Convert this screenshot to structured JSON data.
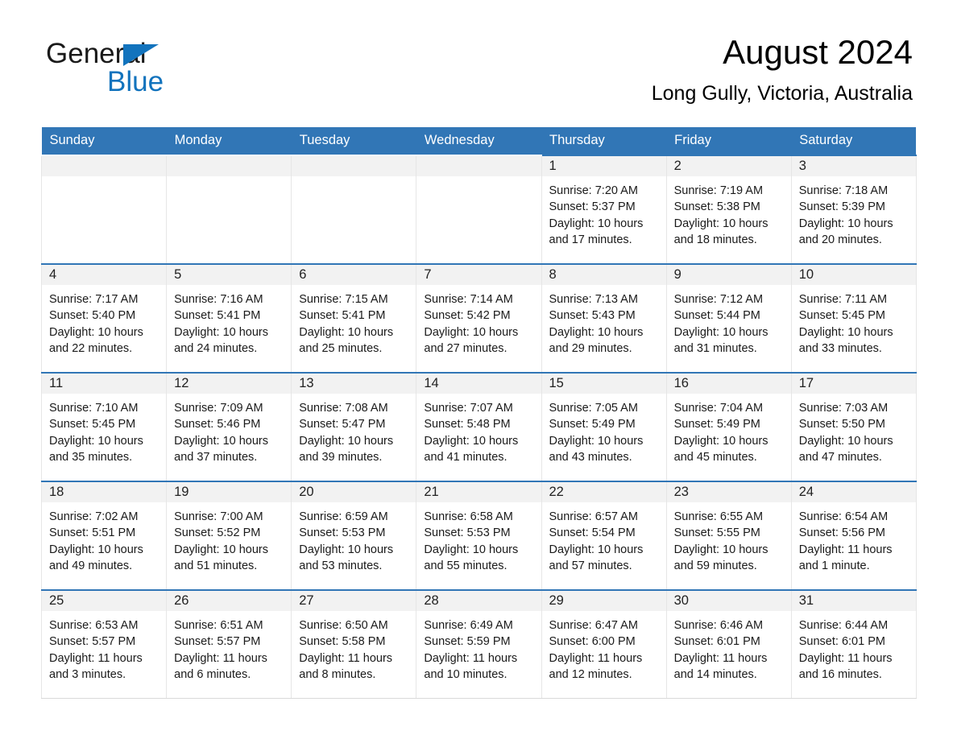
{
  "brand": {
    "word1": "General",
    "word2": "Blue",
    "accent_color": "#1273bd"
  },
  "header": {
    "title": "August 2024",
    "location": "Long Gully, Victoria, Australia"
  },
  "theme": {
    "header_blue": "#3176b6",
    "daynum_band": "#f2f2f2",
    "cell_bg": "#ffffff",
    "text": "#1a1a1a"
  },
  "calendar": {
    "weekday_headers": [
      "Sunday",
      "Monday",
      "Tuesday",
      "Wednesday",
      "Thursday",
      "Friday",
      "Saturday"
    ],
    "weeks": [
      [
        {
          "day": "",
          "sunrise": "",
          "sunset": "",
          "daylight_line1": "",
          "daylight_line2": ""
        },
        {
          "day": "",
          "sunrise": "",
          "sunset": "",
          "daylight_line1": "",
          "daylight_line2": ""
        },
        {
          "day": "",
          "sunrise": "",
          "sunset": "",
          "daylight_line1": "",
          "daylight_line2": ""
        },
        {
          "day": "",
          "sunrise": "",
          "sunset": "",
          "daylight_line1": "",
          "daylight_line2": ""
        },
        {
          "day": "1",
          "sunrise": "Sunrise: 7:20 AM",
          "sunset": "Sunset: 5:37 PM",
          "daylight_line1": "Daylight: 10 hours",
          "daylight_line2": "and 17 minutes."
        },
        {
          "day": "2",
          "sunrise": "Sunrise: 7:19 AM",
          "sunset": "Sunset: 5:38 PM",
          "daylight_line1": "Daylight: 10 hours",
          "daylight_line2": "and 18 minutes."
        },
        {
          "day": "3",
          "sunrise": "Sunrise: 7:18 AM",
          "sunset": "Sunset: 5:39 PM",
          "daylight_line1": "Daylight: 10 hours",
          "daylight_line2": "and 20 minutes."
        }
      ],
      [
        {
          "day": "4",
          "sunrise": "Sunrise: 7:17 AM",
          "sunset": "Sunset: 5:40 PM",
          "daylight_line1": "Daylight: 10 hours",
          "daylight_line2": "and 22 minutes."
        },
        {
          "day": "5",
          "sunrise": "Sunrise: 7:16 AM",
          "sunset": "Sunset: 5:41 PM",
          "daylight_line1": "Daylight: 10 hours",
          "daylight_line2": "and 24 minutes."
        },
        {
          "day": "6",
          "sunrise": "Sunrise: 7:15 AM",
          "sunset": "Sunset: 5:41 PM",
          "daylight_line1": "Daylight: 10 hours",
          "daylight_line2": "and 25 minutes."
        },
        {
          "day": "7",
          "sunrise": "Sunrise: 7:14 AM",
          "sunset": "Sunset: 5:42 PM",
          "daylight_line1": "Daylight: 10 hours",
          "daylight_line2": "and 27 minutes."
        },
        {
          "day": "8",
          "sunrise": "Sunrise: 7:13 AM",
          "sunset": "Sunset: 5:43 PM",
          "daylight_line1": "Daylight: 10 hours",
          "daylight_line2": "and 29 minutes."
        },
        {
          "day": "9",
          "sunrise": "Sunrise: 7:12 AM",
          "sunset": "Sunset: 5:44 PM",
          "daylight_line1": "Daylight: 10 hours",
          "daylight_line2": "and 31 minutes."
        },
        {
          "day": "10",
          "sunrise": "Sunrise: 7:11 AM",
          "sunset": "Sunset: 5:45 PM",
          "daylight_line1": "Daylight: 10 hours",
          "daylight_line2": "and 33 minutes."
        }
      ],
      [
        {
          "day": "11",
          "sunrise": "Sunrise: 7:10 AM",
          "sunset": "Sunset: 5:45 PM",
          "daylight_line1": "Daylight: 10 hours",
          "daylight_line2": "and 35 minutes."
        },
        {
          "day": "12",
          "sunrise": "Sunrise: 7:09 AM",
          "sunset": "Sunset: 5:46 PM",
          "daylight_line1": "Daylight: 10 hours",
          "daylight_line2": "and 37 minutes."
        },
        {
          "day": "13",
          "sunrise": "Sunrise: 7:08 AM",
          "sunset": "Sunset: 5:47 PM",
          "daylight_line1": "Daylight: 10 hours",
          "daylight_line2": "and 39 minutes."
        },
        {
          "day": "14",
          "sunrise": "Sunrise: 7:07 AM",
          "sunset": "Sunset: 5:48 PM",
          "daylight_line1": "Daylight: 10 hours",
          "daylight_line2": "and 41 minutes."
        },
        {
          "day": "15",
          "sunrise": "Sunrise: 7:05 AM",
          "sunset": "Sunset: 5:49 PM",
          "daylight_line1": "Daylight: 10 hours",
          "daylight_line2": "and 43 minutes."
        },
        {
          "day": "16",
          "sunrise": "Sunrise: 7:04 AM",
          "sunset": "Sunset: 5:49 PM",
          "daylight_line1": "Daylight: 10 hours",
          "daylight_line2": "and 45 minutes."
        },
        {
          "day": "17",
          "sunrise": "Sunrise: 7:03 AM",
          "sunset": "Sunset: 5:50 PM",
          "daylight_line1": "Daylight: 10 hours",
          "daylight_line2": "and 47 minutes."
        }
      ],
      [
        {
          "day": "18",
          "sunrise": "Sunrise: 7:02 AM",
          "sunset": "Sunset: 5:51 PM",
          "daylight_line1": "Daylight: 10 hours",
          "daylight_line2": "and 49 minutes."
        },
        {
          "day": "19",
          "sunrise": "Sunrise: 7:00 AM",
          "sunset": "Sunset: 5:52 PM",
          "daylight_line1": "Daylight: 10 hours",
          "daylight_line2": "and 51 minutes."
        },
        {
          "day": "20",
          "sunrise": "Sunrise: 6:59 AM",
          "sunset": "Sunset: 5:53 PM",
          "daylight_line1": "Daylight: 10 hours",
          "daylight_line2": "and 53 minutes."
        },
        {
          "day": "21",
          "sunrise": "Sunrise: 6:58 AM",
          "sunset": "Sunset: 5:53 PM",
          "daylight_line1": "Daylight: 10 hours",
          "daylight_line2": "and 55 minutes."
        },
        {
          "day": "22",
          "sunrise": "Sunrise: 6:57 AM",
          "sunset": "Sunset: 5:54 PM",
          "daylight_line1": "Daylight: 10 hours",
          "daylight_line2": "and 57 minutes."
        },
        {
          "day": "23",
          "sunrise": "Sunrise: 6:55 AM",
          "sunset": "Sunset: 5:55 PM",
          "daylight_line1": "Daylight: 10 hours",
          "daylight_line2": "and 59 minutes."
        },
        {
          "day": "24",
          "sunrise": "Sunrise: 6:54 AM",
          "sunset": "Sunset: 5:56 PM",
          "daylight_line1": "Daylight: 11 hours",
          "daylight_line2": "and 1 minute."
        }
      ],
      [
        {
          "day": "25",
          "sunrise": "Sunrise: 6:53 AM",
          "sunset": "Sunset: 5:57 PM",
          "daylight_line1": "Daylight: 11 hours",
          "daylight_line2": "and 3 minutes."
        },
        {
          "day": "26",
          "sunrise": "Sunrise: 6:51 AM",
          "sunset": "Sunset: 5:57 PM",
          "daylight_line1": "Daylight: 11 hours",
          "daylight_line2": "and 6 minutes."
        },
        {
          "day": "27",
          "sunrise": "Sunrise: 6:50 AM",
          "sunset": "Sunset: 5:58 PM",
          "daylight_line1": "Daylight: 11 hours",
          "daylight_line2": "and 8 minutes."
        },
        {
          "day": "28",
          "sunrise": "Sunrise: 6:49 AM",
          "sunset": "Sunset: 5:59 PM",
          "daylight_line1": "Daylight: 11 hours",
          "daylight_line2": "and 10 minutes."
        },
        {
          "day": "29",
          "sunrise": "Sunrise: 6:47 AM",
          "sunset": "Sunset: 6:00 PM",
          "daylight_line1": "Daylight: 11 hours",
          "daylight_line2": "and 12 minutes."
        },
        {
          "day": "30",
          "sunrise": "Sunrise: 6:46 AM",
          "sunset": "Sunset: 6:01 PM",
          "daylight_line1": "Daylight: 11 hours",
          "daylight_line2": "and 14 minutes."
        },
        {
          "day": "31",
          "sunrise": "Sunrise: 6:44 AM",
          "sunset": "Sunset: 6:01 PM",
          "daylight_line1": "Daylight: 11 hours",
          "daylight_line2": "and 16 minutes."
        }
      ]
    ]
  }
}
